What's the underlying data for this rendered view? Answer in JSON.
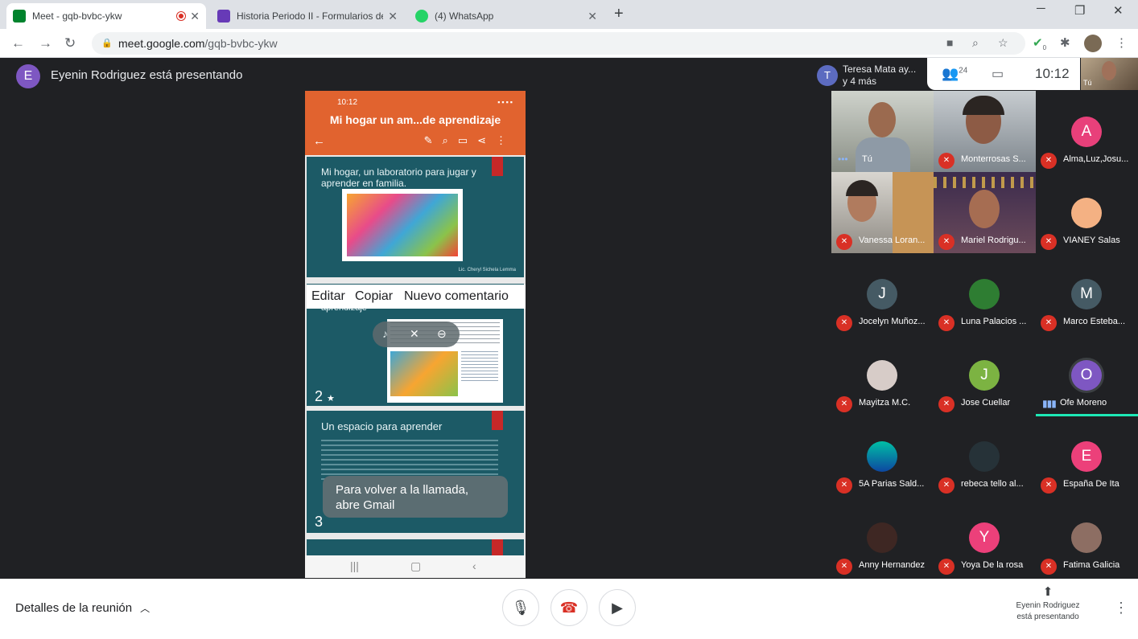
{
  "browser": {
    "tabs": [
      {
        "title": "Meet - gqb-bvbc-ykw",
        "favicon_color": "#00832d"
      },
      {
        "title": "Historia Periodo II - Formularios de",
        "favicon_color": "#673ab7"
      },
      {
        "title": "(4) WhatsApp",
        "favicon_color": "#25d366"
      }
    ],
    "new_tab": "+",
    "url_host": "meet.google.com",
    "url_path": "/gqb-bvbc-ykw",
    "extension_badge": "0"
  },
  "presenter": {
    "initial": "E",
    "text": "Eyenin Rodriguez está presentando"
  },
  "phone": {
    "time": "10:12",
    "title": "Mi hogar un am...de aprendizaje",
    "slide1_title": "Mi hogar, un laboratorio para jugar y aprender en familia.",
    "slide1_footer": "Lic. Cheryl Sichela Lemma",
    "context_menu": [
      "Editar",
      "Copiar",
      "Nuevo comentario"
    ],
    "slide2_partial": "aprendizaje",
    "slide2_num": "2",
    "slide3_title": "Un espacio para aprender",
    "slide3_num": "3",
    "toast": [
      "Para volver a la llamada,",
      "abre Gmail"
    ]
  },
  "meeting": {
    "initial": "T",
    "line1": "Teresa Mata ay...",
    "line2": "y 4 más",
    "participants_count": "24",
    "clock": "10:12",
    "self_label": "Tú"
  },
  "participants": [
    {
      "name": "Tú",
      "type": "video",
      "muted": false
    },
    {
      "name": "Monterrosas S...",
      "type": "video",
      "muted": true
    },
    {
      "name": "Alma,Luz,Josu...",
      "type": "avatar",
      "initial": "A",
      "color": "#e8407a",
      "muted": true
    },
    {
      "name": "Vanessa Loran...",
      "type": "video",
      "muted": true
    },
    {
      "name": "Mariel Rodrigu...",
      "type": "video",
      "muted": true
    },
    {
      "name": "VIANEY Salas",
      "type": "photo",
      "color": "#f4b183",
      "muted": true
    },
    {
      "name": "Jocelyn Muñoz...",
      "type": "avatar",
      "initial": "J",
      "color": "#455a64",
      "muted": true
    },
    {
      "name": "Luna Palacios ...",
      "type": "photo",
      "color": "#2e7d32",
      "muted": true
    },
    {
      "name": "Marco Esteba...",
      "type": "avatar",
      "initial": "M",
      "color": "#455a64",
      "muted": true
    },
    {
      "name": "Mayitza M.C.",
      "type": "photo",
      "color": "#d7ccc8",
      "muted": true
    },
    {
      "name": "Jose Cuellar",
      "type": "avatar",
      "initial": "J",
      "color": "#7cb342",
      "muted": true
    },
    {
      "name": "Ofe Moreno",
      "type": "avatar",
      "initial": "O",
      "color": "#7e57c2",
      "muted": false,
      "speaking": true
    },
    {
      "name": "5A Parias Sald...",
      "type": "photo",
      "color": "#1e88a8",
      "muted": true
    },
    {
      "name": "rebeca tello al...",
      "type": "photo",
      "color": "#263238",
      "muted": true
    },
    {
      "name": "España De Ita",
      "type": "avatar",
      "initial": "E",
      "color": "#ec407a",
      "muted": true
    },
    {
      "name": "Anny Hernandez",
      "type": "photo",
      "color": "#3e2723",
      "muted": true
    },
    {
      "name": "Yoya De la rosa",
      "type": "avatar",
      "initial": "Y",
      "color": "#ec407a",
      "muted": true
    },
    {
      "name": "Fatima Galicia",
      "type": "photo",
      "color": "#8d6e63",
      "muted": true
    }
  ],
  "bottom": {
    "details": "Detalles de la reunión",
    "presenting_line1": "Eyenin Rodriguez",
    "presenting_line2": "está presentando"
  }
}
